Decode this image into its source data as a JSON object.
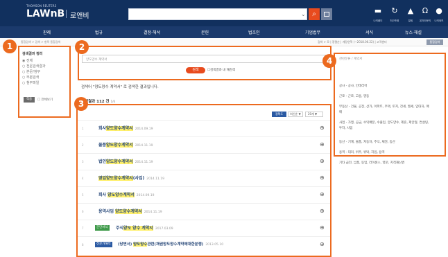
{
  "header": {
    "brand_small": "THOMSON REUTERS",
    "brand": "LAWnB",
    "brand_ko": "로앤비",
    "icons": [
      {
        "name": "folder-icon",
        "glyph": "▬",
        "label": "나의폴더"
      },
      {
        "name": "history-icon",
        "glyph": "↻",
        "label": "최근조회"
      },
      {
        "name": "bell-icon",
        "glyph": "▲",
        "label": "알림"
      },
      {
        "name": "headset-icon",
        "glyph": "Ω",
        "label": "온라인문의"
      },
      {
        "name": "user-icon",
        "glyph": "●",
        "label": "나의정보"
      }
    ]
  },
  "nav": {
    "items": [
      "판례",
      "법규",
      "결정·해석",
      "문헌",
      "법조인",
      "기업법무",
      "서식",
      "뉴스·해설"
    ]
  },
  "breadcrumb": {
    "path": "통합검색 > 검색 > 항목 통합검색",
    "right": "검색 > 로 | 정렬순 | 개정연혁 (~2018.06.22) | 고객센터",
    "button": "통합검색"
  },
  "left_panel": {
    "title": "검색결과 정리",
    "options": [
      "전체",
      "전문검색결과",
      "본문/첨부",
      "부분검색",
      "첨부파일"
    ],
    "apply": "적용",
    "reset": "전체보기"
  },
  "search": {
    "query": "양도양수 계약서",
    "button": "검색",
    "history_label": "검색결과 내 재검색"
  },
  "results": {
    "message": "검색어 \"양도양수 계약서\" 로 검색한 결과입니다.",
    "count_label": "검색결과 112 건",
    "page_info": "1/6",
    "sort_accuracy": "정확도",
    "sort_recent": "최신순 ▼",
    "per_page": "20개 ▼",
    "items": [
      {
        "num": "1",
        "tag": "",
        "pre": "회사",
        "hl": "양도양수계약서",
        "post": "",
        "date": "2014.09.19"
      },
      {
        "num": "2",
        "tag": "",
        "pre": "물품",
        "hl": "양도양수계약서",
        "post": "",
        "date": "2014.11.19"
      },
      {
        "num": "3",
        "tag": "",
        "pre": "법인",
        "hl": "양도양수계약서",
        "post": "",
        "date": "2014.11.19"
      },
      {
        "num": "4",
        "tag": "",
        "pre": "",
        "hl": "영업양도양수계약서",
        "post": "(사업)",
        "date": "2014.11.19"
      },
      {
        "num": "5",
        "tag": "",
        "pre": "회사 ",
        "hl": "양도양수계약서",
        "post": "",
        "date": "2014.09.19"
      },
      {
        "num": "6",
        "tag": "",
        "pre": "용역사업 ",
        "hl": "양도양수계약서",
        "post": "",
        "date": "2014.11.19"
      },
      {
        "num": "7",
        "tag": "간단서식",
        "pre": "주식",
        "hl": "양도 양수 계약서",
        "post": "",
        "date": "2017.03.09"
      },
      {
        "num": "8",
        "tag": "전문가해석",
        "pre": "(당변서) ",
        "hl": "양도양수",
        "post": "관련(채권양도양수계약에대한분쟁)",
        "date": "2013.05.10"
      }
    ]
  },
  "related": {
    "title": "관련분류 / 계약서",
    "items": [
      "공사 - 공사, 인테리어",
      "근로 - 근로, 고용, 영동",
      "부동산 - 건물, 공장, 상가, 아파트, 주택, 토지, 전세, 월세, 임대차, 매매",
      "사업 - 가맹, 공급, 수익배분, 수출입, 양도양수, 제휴, 제안형, 컨설팅, 투자, 사업",
      "동산 - 기계, 물품, 자동차, 주식, 채권, 동산",
      "용역 - 대리, 위주, 위탁, 지입, 용역",
      "기타 금전, 납품, 동업, 라이센스, 영문, 지적재산권"
    ]
  },
  "annotations": [
    "1",
    "2",
    "3",
    "4"
  ],
  "colors": {
    "header": "#11305e",
    "nav": "#1b3a6c",
    "accent": "#e84b1e",
    "frame": "#ec6a1f",
    "highlight": "#fff06a"
  }
}
